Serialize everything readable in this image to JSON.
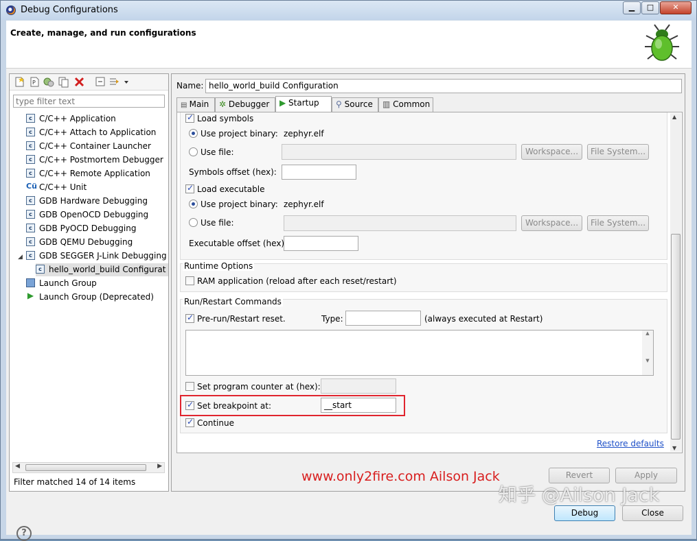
{
  "window": {
    "title": "Debug Configurations",
    "min": "▁",
    "max": "□",
    "close": "✕"
  },
  "header": {
    "title": "Create, manage, and run configurations"
  },
  "left": {
    "filter_placeholder": "type filter text",
    "tree": [
      {
        "label": "C/C++ Application",
        "icon": "c-config-icon"
      },
      {
        "label": "C/C++ Attach to Application",
        "icon": "c-config-icon"
      },
      {
        "label": "C/C++ Container Launcher",
        "icon": "c-config-icon"
      },
      {
        "label": "C/C++ Postmortem Debugger",
        "icon": "c-config-icon"
      },
      {
        "label": "C/C++ Remote Application",
        "icon": "c-config-icon"
      },
      {
        "label": "C/C++ Unit",
        "icon": "unit-test-icon"
      },
      {
        "label": "GDB Hardware Debugging",
        "icon": "c-config-icon"
      },
      {
        "label": "GDB OpenOCD Debugging",
        "icon": "c-config-icon"
      },
      {
        "label": "GDB PyOCD Debugging",
        "icon": "c-config-icon"
      },
      {
        "label": "GDB QEMU Debugging",
        "icon": "c-config-icon"
      },
      {
        "label": "GDB SEGGER J-Link Debugging",
        "icon": "c-config-icon"
      },
      {
        "label": "hello_world_build Configurat",
        "icon": "c-config-icon"
      },
      {
        "label": "Launch Group",
        "icon": "launch-group-icon"
      },
      {
        "label": "Launch Group (Deprecated)",
        "icon": "play-icon"
      }
    ],
    "status": "Filter matched 14 of 14 items"
  },
  "right": {
    "name_label": "Name:",
    "name_value": "hello_world_build Configuration",
    "tabs": [
      "Main",
      "Debugger",
      "Startup",
      "Source",
      "Common"
    ],
    "active_tab": "Startup",
    "load_symbols": "Load symbols",
    "use_project_binary": "Use project binary:",
    "symbols_binary": "zephyr.elf",
    "use_file": "Use file:",
    "workspace_btn": "Workspace...",
    "filesystem_btn": "File System...",
    "symbols_offset": "Symbols offset (hex):",
    "load_executable": "Load executable",
    "exec_binary": "zephyr.elf",
    "executable_offset": "Executable offset (hex):",
    "runtime_options": "Runtime Options",
    "ram_application": "RAM application (reload after each reset/restart)",
    "run_restart_commands": "Run/Restart Commands",
    "prerun_reset": "Pre-run/Restart reset.",
    "type_label": "Type:",
    "always_executed": "(always executed at Restart)",
    "set_pc": "Set program counter at (hex):",
    "set_breakpoint": "Set breakpoint at:",
    "breakpoint_value": "__start",
    "continue": "Continue",
    "restore_defaults": "Restore defaults",
    "revert": "Revert",
    "apply": "Apply"
  },
  "footer": {
    "debug": "Debug",
    "close": "Close",
    "help": "?"
  },
  "watermark": {
    "site": "www.only2fire.com  Ailson Jack",
    "zhihu": "知乎 @Ailson Jack"
  }
}
